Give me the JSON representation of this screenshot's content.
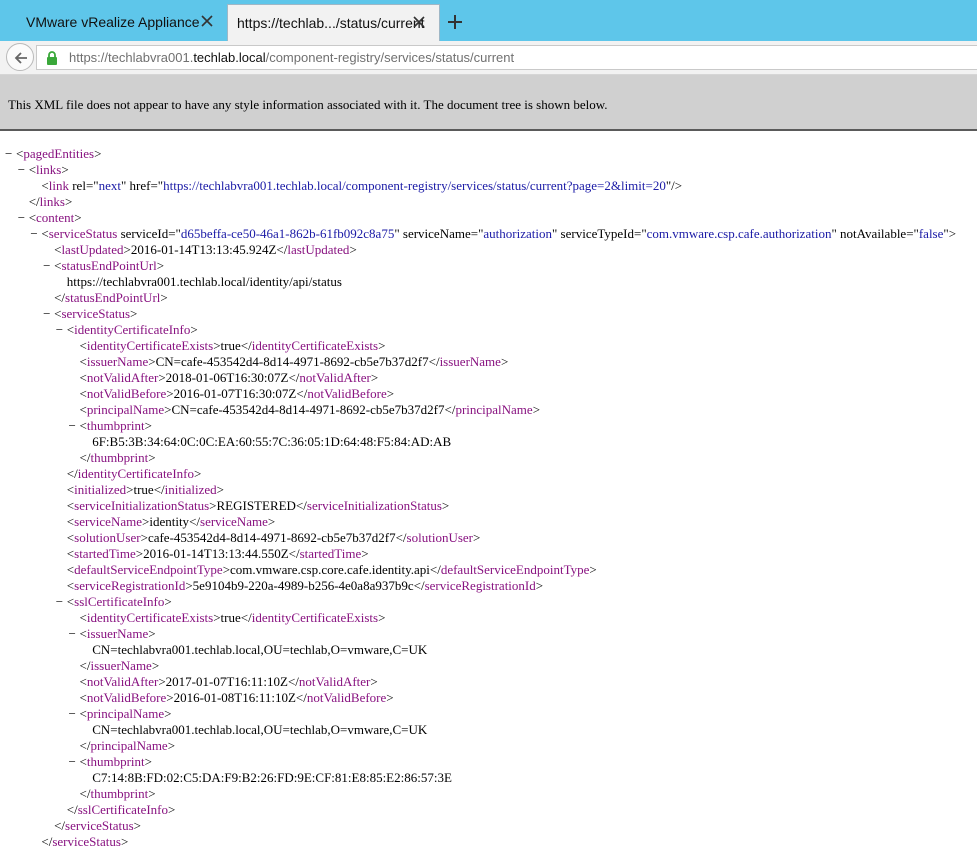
{
  "browser": {
    "tabs": [
      {
        "label": "VMware vRealize Appliance",
        "active": false
      },
      {
        "label": "https://techlab.../status/current",
        "active": true
      }
    ],
    "url": {
      "prefix": "https://techlabvra001.",
      "host": "techlab.local",
      "path": "/component-registry/services/status/current"
    }
  },
  "banner": {
    "text": "This XML file does not appear to have any style information associated with it. The document tree is shown below."
  },
  "xml_lines": [
    {
      "d": 0,
      "t": 1,
      "s": [
        [
          "<",
          "p"
        ],
        [
          "pagedEntities",
          "t"
        ],
        [
          ">",
          "p"
        ]
      ]
    },
    {
      "d": 1,
      "t": 1,
      "s": [
        [
          "<",
          "p"
        ],
        [
          "links",
          "t"
        ],
        [
          ">",
          "p"
        ]
      ]
    },
    {
      "d": 2,
      "t": 0,
      "s": [
        [
          "<",
          "p"
        ],
        [
          "link",
          "t"
        ],
        [
          " rel",
          "a"
        ],
        [
          "=\"",
          "p"
        ],
        [
          "next",
          "v"
        ],
        [
          "\"",
          "p"
        ],
        [
          " href",
          "a"
        ],
        [
          "=\"",
          "p"
        ],
        [
          "https://techlabvra001.techlab.local/component-registry/services/status/current?page=2&limit=20",
          "v"
        ],
        [
          "\"",
          "p"
        ],
        [
          "/>",
          "p"
        ]
      ]
    },
    {
      "d": 1,
      "t": 0,
      "s": [
        [
          "</",
          "p"
        ],
        [
          "links",
          "t"
        ],
        [
          ">",
          "p"
        ]
      ]
    },
    {
      "d": 1,
      "t": 1,
      "s": [
        [
          "<",
          "p"
        ],
        [
          "content",
          "t"
        ],
        [
          ">",
          "p"
        ]
      ]
    },
    {
      "d": 2,
      "t": 1,
      "s": [
        [
          "<",
          "p"
        ],
        [
          "serviceStatus",
          "t"
        ],
        [
          " serviceId",
          "a"
        ],
        [
          "=\"",
          "p"
        ],
        [
          "d65beffa-ce50-46a1-862b-61fb092c8a75",
          "v"
        ],
        [
          "\"",
          "p"
        ],
        [
          " serviceName",
          "a"
        ],
        [
          "=\"",
          "p"
        ],
        [
          "authorization",
          "v"
        ],
        [
          "\"",
          "p"
        ],
        [
          " serviceTypeId",
          "a"
        ],
        [
          "=\"",
          "p"
        ],
        [
          "com.vmware.csp.cafe.authorization",
          "v"
        ],
        [
          "\"",
          "p"
        ],
        [
          " notAvailable",
          "a"
        ],
        [
          "=\"",
          "p"
        ],
        [
          "false",
          "v"
        ],
        [
          "\"",
          "p"
        ],
        [
          ">",
          "p"
        ]
      ]
    },
    {
      "d": 3,
      "t": 0,
      "s": [
        [
          "<",
          "p"
        ],
        [
          "lastUpdated",
          "t"
        ],
        [
          ">",
          "p"
        ],
        [
          "2016-01-14T13:13:45.924Z",
          "x"
        ],
        [
          "</",
          "p"
        ],
        [
          "lastUpdated",
          "t"
        ],
        [
          ">",
          "p"
        ]
      ]
    },
    {
      "d": 3,
      "t": 1,
      "s": [
        [
          "<",
          "p"
        ],
        [
          "statusEndPointUrl",
          "t"
        ],
        [
          ">",
          "p"
        ]
      ]
    },
    {
      "d": 4,
      "t": 0,
      "s": [
        [
          "https://techlabvra001.techlab.local/identity/api/status",
          "x"
        ]
      ]
    },
    {
      "d": 3,
      "t": 0,
      "s": [
        [
          "</",
          "p"
        ],
        [
          "statusEndPointUrl",
          "t"
        ],
        [
          ">",
          "p"
        ]
      ]
    },
    {
      "d": 3,
      "t": 1,
      "s": [
        [
          "<",
          "p"
        ],
        [
          "serviceStatus",
          "t"
        ],
        [
          ">",
          "p"
        ]
      ]
    },
    {
      "d": 4,
      "t": 1,
      "s": [
        [
          "<",
          "p"
        ],
        [
          "identityCertificateInfo",
          "t"
        ],
        [
          ">",
          "p"
        ]
      ]
    },
    {
      "d": 5,
      "t": 0,
      "s": [
        [
          "<",
          "p"
        ],
        [
          "identityCertificateExists",
          "t"
        ],
        [
          ">",
          "p"
        ],
        [
          "true",
          "x"
        ],
        [
          "</",
          "p"
        ],
        [
          "identityCertificateExists",
          "t"
        ],
        [
          ">",
          "p"
        ]
      ]
    },
    {
      "d": 5,
      "t": 0,
      "s": [
        [
          "<",
          "p"
        ],
        [
          "issuerName",
          "t"
        ],
        [
          ">",
          "p"
        ],
        [
          "CN=cafe-453542d4-8d14-4971-8692-cb5e7b37d2f7",
          "x"
        ],
        [
          "</",
          "p"
        ],
        [
          "issuerName",
          "t"
        ],
        [
          ">",
          "p"
        ]
      ]
    },
    {
      "d": 5,
      "t": 0,
      "s": [
        [
          "<",
          "p"
        ],
        [
          "notValidAfter",
          "t"
        ],
        [
          ">",
          "p"
        ],
        [
          "2018-01-06T16:30:07Z",
          "x"
        ],
        [
          "</",
          "p"
        ],
        [
          "notValidAfter",
          "t"
        ],
        [
          ">",
          "p"
        ]
      ]
    },
    {
      "d": 5,
      "t": 0,
      "s": [
        [
          "<",
          "p"
        ],
        [
          "notValidBefore",
          "t"
        ],
        [
          ">",
          "p"
        ],
        [
          "2016-01-07T16:30:07Z",
          "x"
        ],
        [
          "</",
          "p"
        ],
        [
          "notValidBefore",
          "t"
        ],
        [
          ">",
          "p"
        ]
      ]
    },
    {
      "d": 5,
      "t": 0,
      "s": [
        [
          "<",
          "p"
        ],
        [
          "principalName",
          "t"
        ],
        [
          ">",
          "p"
        ],
        [
          "CN=cafe-453542d4-8d14-4971-8692-cb5e7b37d2f7",
          "x"
        ],
        [
          "</",
          "p"
        ],
        [
          "principalName",
          "t"
        ],
        [
          ">",
          "p"
        ]
      ]
    },
    {
      "d": 5,
      "t": 1,
      "s": [
        [
          "<",
          "p"
        ],
        [
          "thumbprint",
          "t"
        ],
        [
          ">",
          "p"
        ]
      ]
    },
    {
      "d": 6,
      "t": 0,
      "s": [
        [
          "6F:B5:3B:34:64:0C:0C:EA:60:55:7C:36:05:1D:64:48:F5:84:AD:AB",
          "x"
        ]
      ]
    },
    {
      "d": 5,
      "t": 0,
      "s": [
        [
          "</",
          "p"
        ],
        [
          "thumbprint",
          "t"
        ],
        [
          ">",
          "p"
        ]
      ]
    },
    {
      "d": 4,
      "t": 0,
      "s": [
        [
          "</",
          "p"
        ],
        [
          "identityCertificateInfo",
          "t"
        ],
        [
          ">",
          "p"
        ]
      ]
    },
    {
      "d": 4,
      "t": 0,
      "s": [
        [
          "<",
          "p"
        ],
        [
          "initialized",
          "t"
        ],
        [
          ">",
          "p"
        ],
        [
          "true",
          "x"
        ],
        [
          "</",
          "p"
        ],
        [
          "initialized",
          "t"
        ],
        [
          ">",
          "p"
        ]
      ]
    },
    {
      "d": 4,
      "t": 0,
      "s": [
        [
          "<",
          "p"
        ],
        [
          "serviceInitializationStatus",
          "t"
        ],
        [
          ">",
          "p"
        ],
        [
          "REGISTERED",
          "x"
        ],
        [
          "</",
          "p"
        ],
        [
          "serviceInitializationStatus",
          "t"
        ],
        [
          ">",
          "p"
        ]
      ]
    },
    {
      "d": 4,
      "t": 0,
      "s": [
        [
          "<",
          "p"
        ],
        [
          "serviceName",
          "t"
        ],
        [
          ">",
          "p"
        ],
        [
          "identity",
          "x"
        ],
        [
          "</",
          "p"
        ],
        [
          "serviceName",
          "t"
        ],
        [
          ">",
          "p"
        ]
      ]
    },
    {
      "d": 4,
      "t": 0,
      "s": [
        [
          "<",
          "p"
        ],
        [
          "solutionUser",
          "t"
        ],
        [
          ">",
          "p"
        ],
        [
          "cafe-453542d4-8d14-4971-8692-cb5e7b37d2f7",
          "x"
        ],
        [
          "</",
          "p"
        ],
        [
          "solutionUser",
          "t"
        ],
        [
          ">",
          "p"
        ]
      ]
    },
    {
      "d": 4,
      "t": 0,
      "s": [
        [
          "<",
          "p"
        ],
        [
          "startedTime",
          "t"
        ],
        [
          ">",
          "p"
        ],
        [
          "2016-01-14T13:13:44.550Z",
          "x"
        ],
        [
          "</",
          "p"
        ],
        [
          "startedTime",
          "t"
        ],
        [
          ">",
          "p"
        ]
      ]
    },
    {
      "d": 4,
      "t": 0,
      "s": [
        [
          "<",
          "p"
        ],
        [
          "defaultServiceEndpointType",
          "t"
        ],
        [
          ">",
          "p"
        ],
        [
          "com.vmware.csp.core.cafe.identity.api",
          "x"
        ],
        [
          "</",
          "p"
        ],
        [
          "defaultServiceEndpointType",
          "t"
        ],
        [
          ">",
          "p"
        ]
      ]
    },
    {
      "d": 4,
      "t": 0,
      "s": [
        [
          "<",
          "p"
        ],
        [
          "serviceRegistrationId",
          "t"
        ],
        [
          ">",
          "p"
        ],
        [
          "5e9104b9-220a-4989-b256-4e0a8a937b9c",
          "x"
        ],
        [
          "</",
          "p"
        ],
        [
          "serviceRegistrationId",
          "t"
        ],
        [
          ">",
          "p"
        ]
      ]
    },
    {
      "d": 4,
      "t": 1,
      "s": [
        [
          "<",
          "p"
        ],
        [
          "sslCertificateInfo",
          "t"
        ],
        [
          ">",
          "p"
        ]
      ]
    },
    {
      "d": 5,
      "t": 0,
      "s": [
        [
          "<",
          "p"
        ],
        [
          "identityCertificateExists",
          "t"
        ],
        [
          ">",
          "p"
        ],
        [
          "true",
          "x"
        ],
        [
          "</",
          "p"
        ],
        [
          "identityCertificateExists",
          "t"
        ],
        [
          ">",
          "p"
        ]
      ]
    },
    {
      "d": 5,
      "t": 1,
      "s": [
        [
          "<",
          "p"
        ],
        [
          "issuerName",
          "t"
        ],
        [
          ">",
          "p"
        ]
      ]
    },
    {
      "d": 6,
      "t": 0,
      "s": [
        [
          "CN=techlabvra001.techlab.local,OU=techlab,O=vmware,C=UK",
          "x"
        ]
      ]
    },
    {
      "d": 5,
      "t": 0,
      "s": [
        [
          "</",
          "p"
        ],
        [
          "issuerName",
          "t"
        ],
        [
          ">",
          "p"
        ]
      ]
    },
    {
      "d": 5,
      "t": 0,
      "s": [
        [
          "<",
          "p"
        ],
        [
          "notValidAfter",
          "t"
        ],
        [
          ">",
          "p"
        ],
        [
          "2017-01-07T16:11:10Z",
          "x"
        ],
        [
          "</",
          "p"
        ],
        [
          "notValidAfter",
          "t"
        ],
        [
          ">",
          "p"
        ]
      ]
    },
    {
      "d": 5,
      "t": 0,
      "s": [
        [
          "<",
          "p"
        ],
        [
          "notValidBefore",
          "t"
        ],
        [
          ">",
          "p"
        ],
        [
          "2016-01-08T16:11:10Z",
          "x"
        ],
        [
          "</",
          "p"
        ],
        [
          "notValidBefore",
          "t"
        ],
        [
          ">",
          "p"
        ]
      ]
    },
    {
      "d": 5,
      "t": 1,
      "s": [
        [
          "<",
          "p"
        ],
        [
          "principalName",
          "t"
        ],
        [
          ">",
          "p"
        ]
      ]
    },
    {
      "d": 6,
      "t": 0,
      "s": [
        [
          "CN=techlabvra001.techlab.local,OU=techlab,O=vmware,C=UK",
          "x"
        ]
      ]
    },
    {
      "d": 5,
      "t": 0,
      "s": [
        [
          "</",
          "p"
        ],
        [
          "principalName",
          "t"
        ],
        [
          ">",
          "p"
        ]
      ]
    },
    {
      "d": 5,
      "t": 1,
      "s": [
        [
          "<",
          "p"
        ],
        [
          "thumbprint",
          "t"
        ],
        [
          ">",
          "p"
        ]
      ]
    },
    {
      "d": 6,
      "t": 0,
      "s": [
        [
          "C7:14:8B:FD:02:C5:DA:F9:B2:26:FD:9E:CF:81:E8:85:E2:86:57:3E",
          "x"
        ]
      ]
    },
    {
      "d": 5,
      "t": 0,
      "s": [
        [
          "</",
          "p"
        ],
        [
          "thumbprint",
          "t"
        ],
        [
          ">",
          "p"
        ]
      ]
    },
    {
      "d": 4,
      "t": 0,
      "s": [
        [
          "</",
          "p"
        ],
        [
          "sslCertificateInfo",
          "t"
        ],
        [
          ">",
          "p"
        ]
      ]
    },
    {
      "d": 3,
      "t": 0,
      "s": [
        [
          "</",
          "p"
        ],
        [
          "serviceStatus",
          "t"
        ],
        [
          ">",
          "p"
        ]
      ]
    },
    {
      "d": 2,
      "t": 0,
      "s": [
        [
          "</",
          "p"
        ],
        [
          "serviceStatus",
          "t"
        ],
        [
          ">",
          "p"
        ]
      ]
    }
  ],
  "colors": {
    "tag": "#881280",
    "attr_value": "#1a1aa6",
    "tabstrip": "#5ec6ea",
    "banner": "#d0d0d0"
  }
}
